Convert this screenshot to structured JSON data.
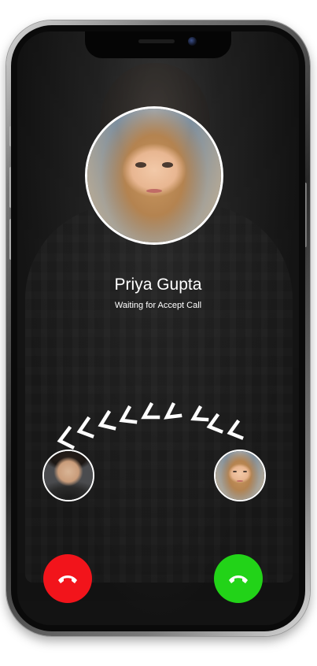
{
  "caller": {
    "name": "Priya Gupta",
    "status": "Waiting for Accept Call"
  },
  "actions": {
    "decline_icon": "phone-hangup-icon",
    "accept_icon": "phone-hangup-icon"
  },
  "colors": {
    "decline": "#f2141b",
    "accept": "#22d318",
    "text": "#ffffff"
  }
}
